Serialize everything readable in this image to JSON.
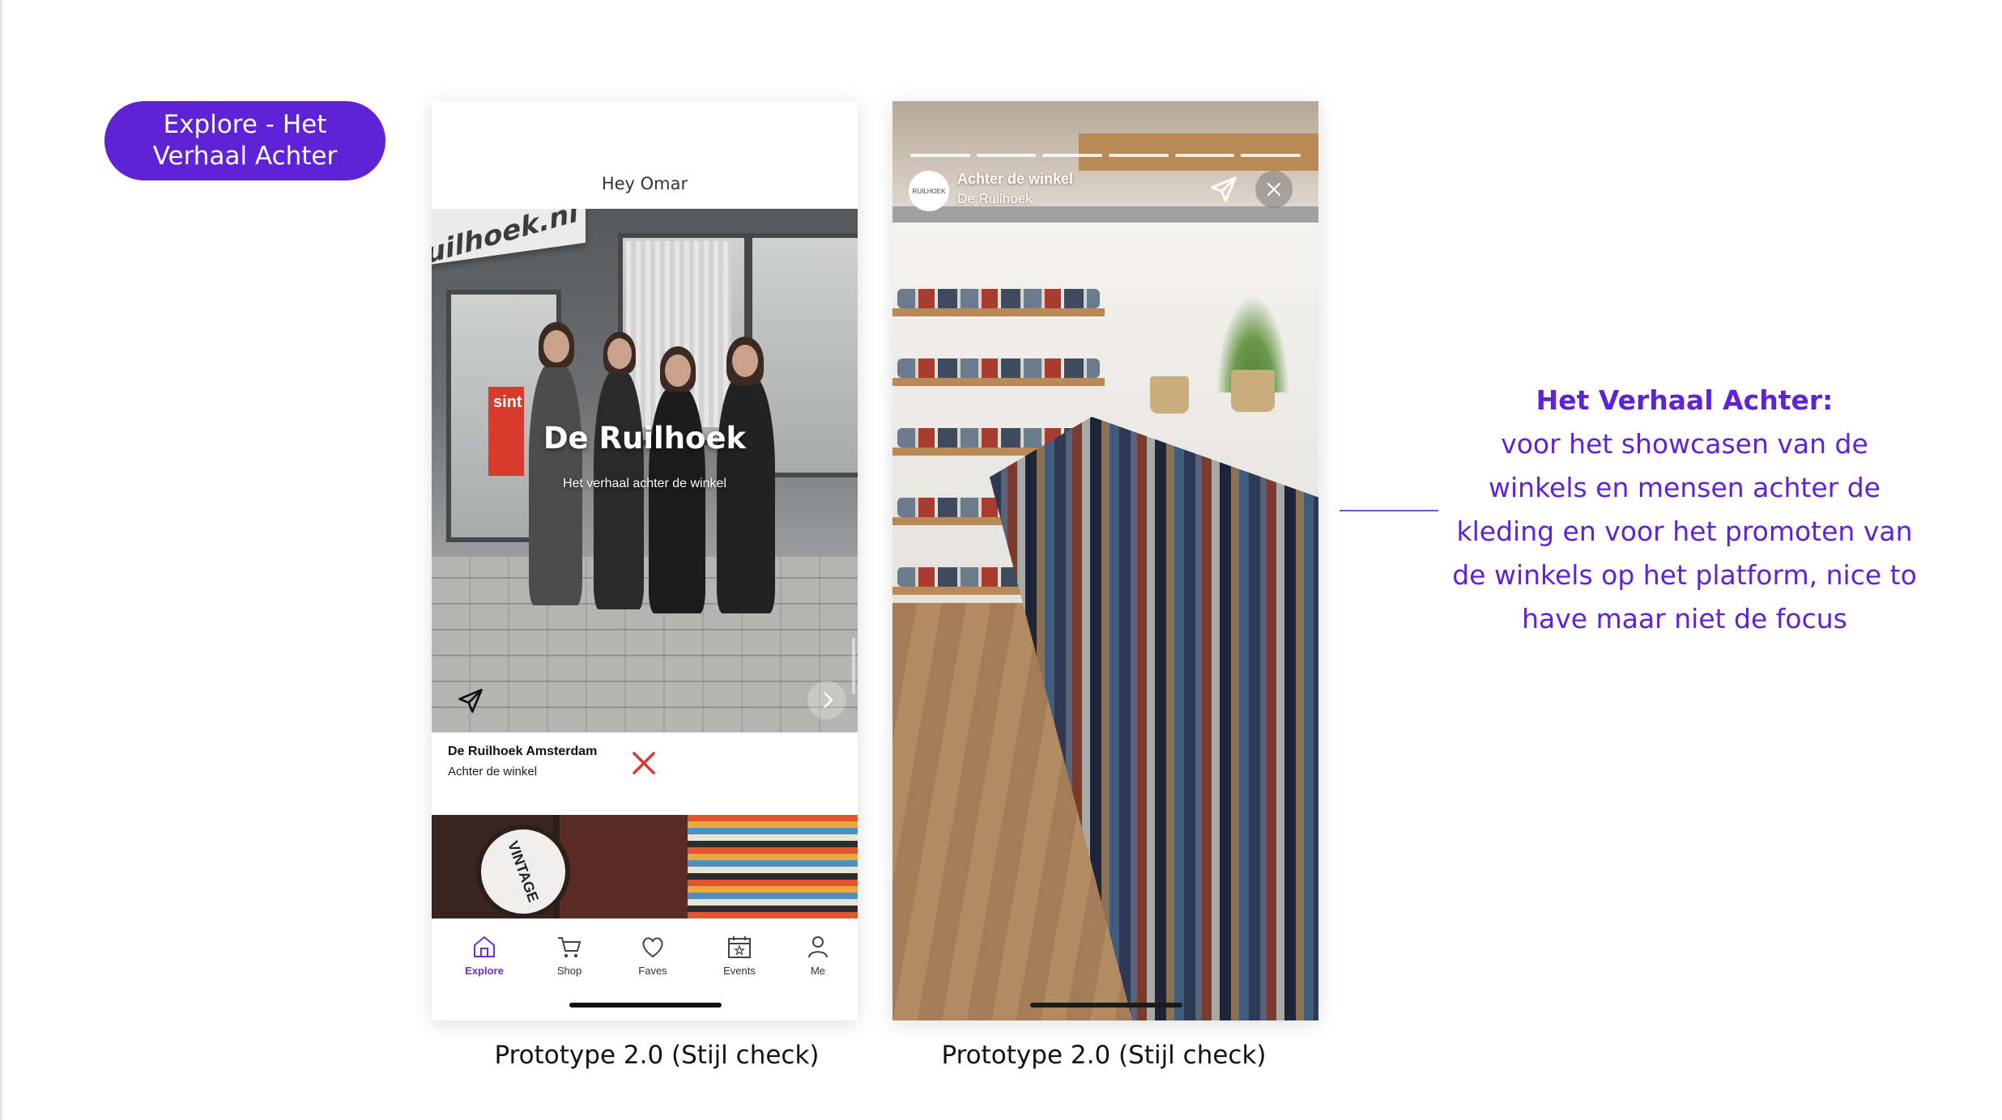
{
  "slide_label": "Explore - Het Verhaal Achter",
  "phone1": {
    "greeting": "Hey Omar",
    "hero": {
      "awning_text": "uilhoek.nl",
      "sign_text": "sint",
      "title": "De Ruilhoek",
      "subtitle": "Het verhaal achter de winkel"
    },
    "card": {
      "title": "De Ruilhoek Amsterdam",
      "subtitle": "Achter de winkel"
    },
    "second_card_sign": "VINTAGE",
    "tabs": [
      {
        "label": "Explore",
        "icon": "home-icon",
        "active": true
      },
      {
        "label": "Shop",
        "icon": "cart-icon",
        "active": false
      },
      {
        "label": "Faves",
        "icon": "heart-icon",
        "active": false
      },
      {
        "label": "Events",
        "icon": "calendar-icon",
        "active": false
      },
      {
        "label": "Me",
        "icon": "user-icon",
        "active": false
      }
    ],
    "caption": "Prototype 2.0 (Stijl check)"
  },
  "phone2": {
    "story_logo": "RUILHOEK",
    "story_title": "Achter de winkel",
    "story_subtitle": "De Ruilhoek",
    "caption": "Prototype 2.0 (Stijl check)"
  },
  "note": {
    "heading": "Het Verhaal Achter:",
    "body": "voor het showcasen van de winkels en mensen achter de kleding en voor het promoten van de winkels op het platform, nice to have maar niet de focus"
  },
  "colors": {
    "accent": "#5f22d6",
    "close_red": "#d83a35"
  }
}
